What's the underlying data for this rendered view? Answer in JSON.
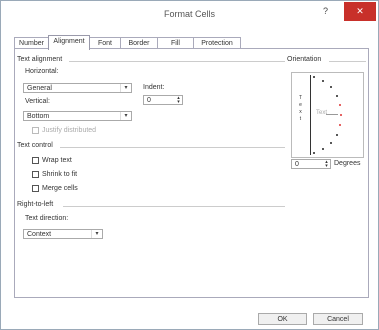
{
  "window": {
    "title": "Format Cells",
    "help_label": "?",
    "close_label": "✕"
  },
  "tabs": [
    "Number",
    "Alignment",
    "Font",
    "Border",
    "Fill",
    "Protection"
  ],
  "text_alignment": {
    "section_label": "Text alignment",
    "horizontal_label": "Horizontal:",
    "horizontal_value": "General",
    "vertical_label": "Vertical:",
    "vertical_value": "Bottom",
    "indent_label": "Indent:",
    "indent_value": "0",
    "justify_label": "Justify distributed"
  },
  "text_control": {
    "section_label": "Text control",
    "wrap_label": "Wrap text",
    "shrink_label": "Shrink to fit",
    "merge_label": "Merge cells"
  },
  "rtl": {
    "section_label": "Right-to-left",
    "direction_label": "Text direction:",
    "direction_value": "Context"
  },
  "orientation": {
    "section_label": "Orientation",
    "vertical_text": [
      "T",
      "e",
      "x",
      "t"
    ],
    "text_label": "Text",
    "degrees_value": "0",
    "degrees_label": "Degrees"
  },
  "footer": {
    "ok_label": "OK",
    "cancel_label": "Cancel"
  },
  "icons": {
    "dropdown": "▾",
    "spin_up": "▴",
    "spin_down": "▾"
  },
  "colors": {
    "close_bg": "#c8302a",
    "orientation_dot_active": "#d33333"
  }
}
